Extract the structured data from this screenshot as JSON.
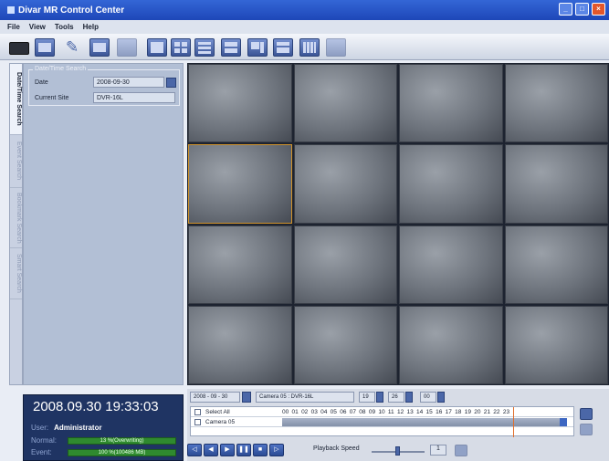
{
  "window": {
    "title": "Divar MR Control Center"
  },
  "menu": [
    "File",
    "View",
    "Tools",
    "Help"
  ],
  "side_tabs": [
    "Date/Time Search",
    "Event Search",
    "Bookmark Search",
    "Smart Search"
  ],
  "search": {
    "legend": "Date/Time Search",
    "date_label": "Date",
    "date_value": "2008-09-30",
    "site_label": "Current Site",
    "site_value": "DVR-16L"
  },
  "status": {
    "datetime": "2008.09.30  19:33:03",
    "user_label": "User:",
    "user_value": "Administrator",
    "normal_label": "Normal:",
    "normal_value": "13 %(Overwriting)",
    "event_label": "Event:",
    "event_value": "100 %(100486 MB)"
  },
  "playback": {
    "date": "2008 - 09 - 30",
    "camera": "Camera 05 : DVR-16L",
    "hour": "19",
    "minute": "26",
    "second": "00",
    "select_all": "Select All",
    "camera_row": "Camera 05",
    "hours": "00 01 02 03 04 05 06 07 08 09 10 11 12 13 14 15 16 17 18 19 20 21 22 23",
    "speed_label": "Playback Speed",
    "speed_value": "1"
  },
  "colors": {
    "accent": "#3c66c2",
    "selected_cell": "#d2932a",
    "progress": "#2f8a2f"
  }
}
